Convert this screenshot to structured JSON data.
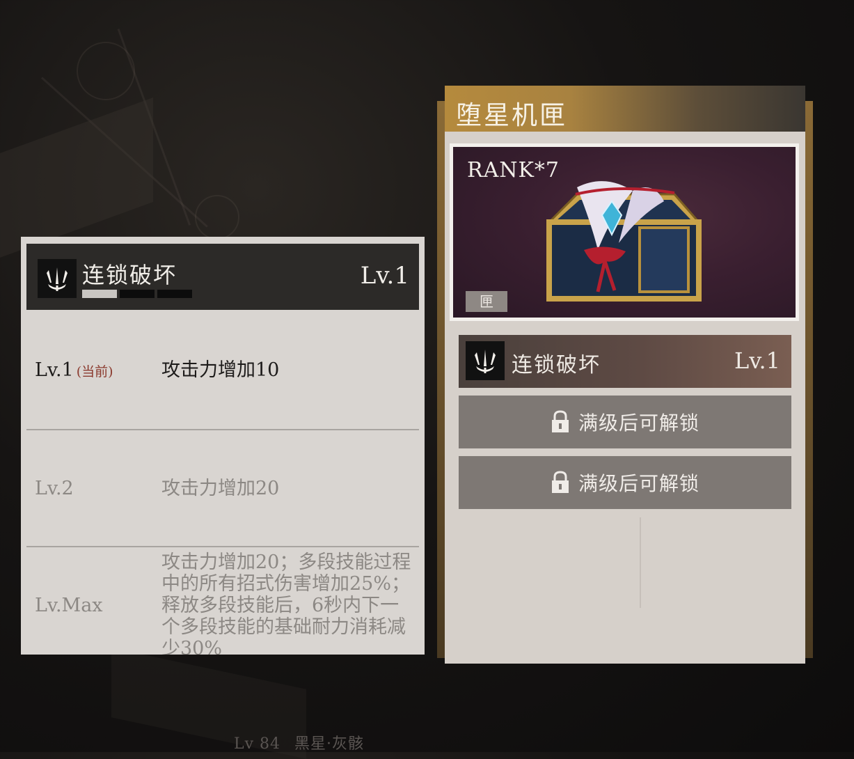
{
  "skill_panel": {
    "name": "连锁破坏",
    "level": "Lv.1",
    "progress": {
      "filled": 1,
      "total": 3
    },
    "levels": [
      {
        "label": "Lv.1",
        "tag": "(当前)",
        "description": "攻击力增加10"
      },
      {
        "label": "Lv.2",
        "tag": "",
        "description": "攻击力增加20"
      },
      {
        "label": "Lv.Max",
        "tag": "",
        "description": "攻击力增加20；多段技能过程中的所有招式伤害增加25%；释放多段技能后，6秒内下一个多段技能的基础耐力消耗减少30%"
      }
    ]
  },
  "item_panel": {
    "title": "堕星机匣",
    "rank": "RANK*7",
    "type_tag": "匣",
    "skill": {
      "name": "连锁破坏",
      "level": "Lv.1"
    },
    "locked_slots": [
      {
        "text": "满级后可解锁"
      },
      {
        "text": "满级后可解锁"
      }
    ]
  },
  "character": {
    "level": "Lv 84",
    "name": "黑星·灰骸"
  },
  "colors": {
    "title_gold": "#b58a3d",
    "current_tag": "#8b3a2e",
    "panel_bg": "#d9d5d1"
  },
  "icons": [
    "trident-skill-icon",
    "lock-icon"
  ]
}
